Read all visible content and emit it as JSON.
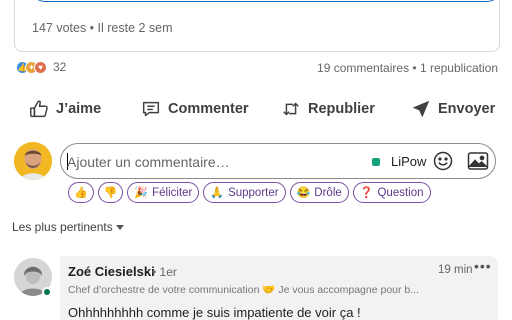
{
  "poll": {
    "meta": "147 votes • Il reste 2 sem"
  },
  "social": {
    "reaction_icons": [
      "like-icon",
      "support-icon",
      "love-icon"
    ],
    "reaction_count": "32",
    "counts": "19 commentaires • 1 republication"
  },
  "actions": {
    "like": "J’aime",
    "comment": "Commenter",
    "repost": "Republier",
    "send": "Envoyer"
  },
  "composer": {
    "placeholder": "Ajouter un commentaire…",
    "account": "LiPow"
  },
  "quick_reactions": {
    "celebrate": "Féliciter",
    "support": "Supporter",
    "funny": "Drôle",
    "question": "Question"
  },
  "sort": {
    "label": "Les plus pertinents"
  },
  "comment": {
    "author": "Zoé Ciesielski",
    "degree": "• 1er",
    "time": "19 min",
    "more": "•••",
    "headline": "Chef d’orchestre de votre communication 🤝 Je vous accompagne pour b...",
    "body": "Ohhhhhhhhh comme je suis impatiente de voir ça !"
  },
  "colors": {
    "accent": "#0a66c2",
    "chip_border": "#7b4fa8",
    "online": "#01754f",
    "avatar_bg": "#f2b824"
  }
}
